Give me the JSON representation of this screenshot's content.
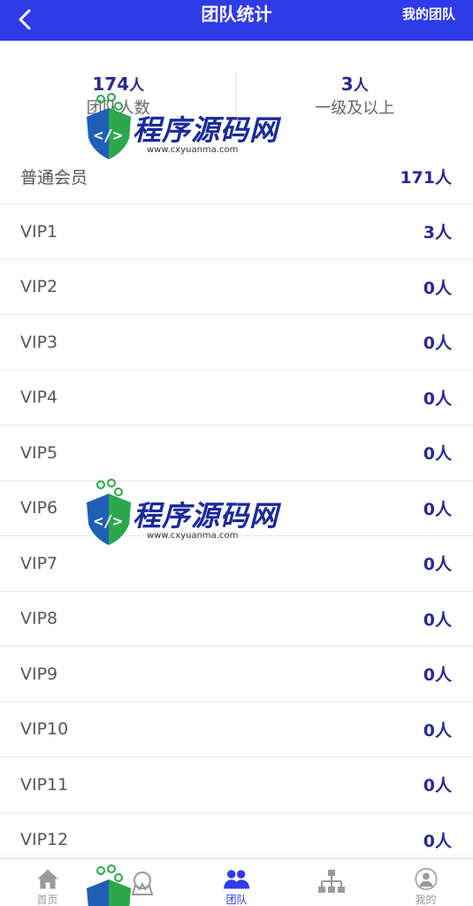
{
  "header": {
    "title": "团队统计",
    "right_label": "我的团队",
    "back_icon": "chevron-left-icon",
    "background": "#2f3be8"
  },
  "summary": {
    "left": {
      "value": "174",
      "unit": "人",
      "label": "团队人数"
    },
    "right": {
      "value": "3",
      "unit": "人",
      "label": "一级及以上"
    }
  },
  "rows": [
    {
      "label": "普通会员",
      "value": "171人"
    },
    {
      "label": "VIP1",
      "value": "3人"
    },
    {
      "label": "VIP2",
      "value": "0人"
    },
    {
      "label": "VIP3",
      "value": "0人"
    },
    {
      "label": "VIP4",
      "value": "0人"
    },
    {
      "label": "VIP5",
      "value": "0人"
    },
    {
      "label": "VIP6",
      "value": "0人"
    },
    {
      "label": "VIP7",
      "value": "0人"
    },
    {
      "label": "VIP8",
      "value": "0人"
    },
    {
      "label": "VIP9",
      "value": "0人"
    },
    {
      "label": "VIP10",
      "value": "0人"
    },
    {
      "label": "VIP11",
      "value": "0人"
    },
    {
      "label": "VIP12",
      "value": "0人"
    }
  ],
  "bottom_nav": [
    {
      "icon": "home-icon",
      "label": "首页",
      "active": false
    },
    {
      "icon": "crown-icon",
      "label": "",
      "active": false
    },
    {
      "icon": "team-icon",
      "label": "团队",
      "active": true
    },
    {
      "icon": "hierarchy-icon",
      "label": "",
      "active": false
    },
    {
      "icon": "user-icon",
      "label": "我的",
      "active": false
    }
  ],
  "watermark": {
    "text": "程序源码网",
    "url": "www.cxyuanma.com"
  },
  "colors": {
    "accent": "#2f3be8",
    "value_text": "#2a2a8f"
  }
}
